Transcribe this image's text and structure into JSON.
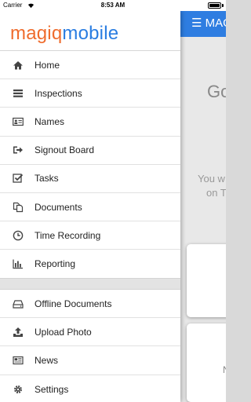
{
  "status_bar": {
    "carrier": "Carrier",
    "time": "8:53 AM",
    "battery_level": 1.0
  },
  "logo": {
    "part1": "magiq",
    "part2": "mobile",
    "color1": "#ef6c2d",
    "color2": "#2a7de1"
  },
  "background_app": {
    "header_color": "#2e7de1",
    "menu_button": "☰ MAG",
    "greeting": "Go",
    "info_line1": "You w",
    "info_line2": "on T",
    "card2_text": "N"
  },
  "menu": {
    "primary": [
      {
        "label": "Home",
        "icon": "home-icon"
      },
      {
        "label": "Inspections",
        "icon": "inspections-icon"
      },
      {
        "label": "Names",
        "icon": "id-card-icon"
      },
      {
        "label": "Signout Board",
        "icon": "sign-out-icon"
      },
      {
        "label": "Tasks",
        "icon": "checkbox-icon"
      },
      {
        "label": "Documents",
        "icon": "documents-icon"
      },
      {
        "label": "Time Recording",
        "icon": "clock-icon"
      },
      {
        "label": "Reporting",
        "icon": "bar-chart-icon"
      }
    ],
    "secondary": [
      {
        "label": "Offline Documents",
        "icon": "hard-drive-icon"
      },
      {
        "label": "Upload Photo",
        "icon": "upload-icon"
      },
      {
        "label": "News",
        "icon": "newspaper-icon"
      },
      {
        "label": "Settings",
        "icon": "gear-icon"
      }
    ]
  }
}
